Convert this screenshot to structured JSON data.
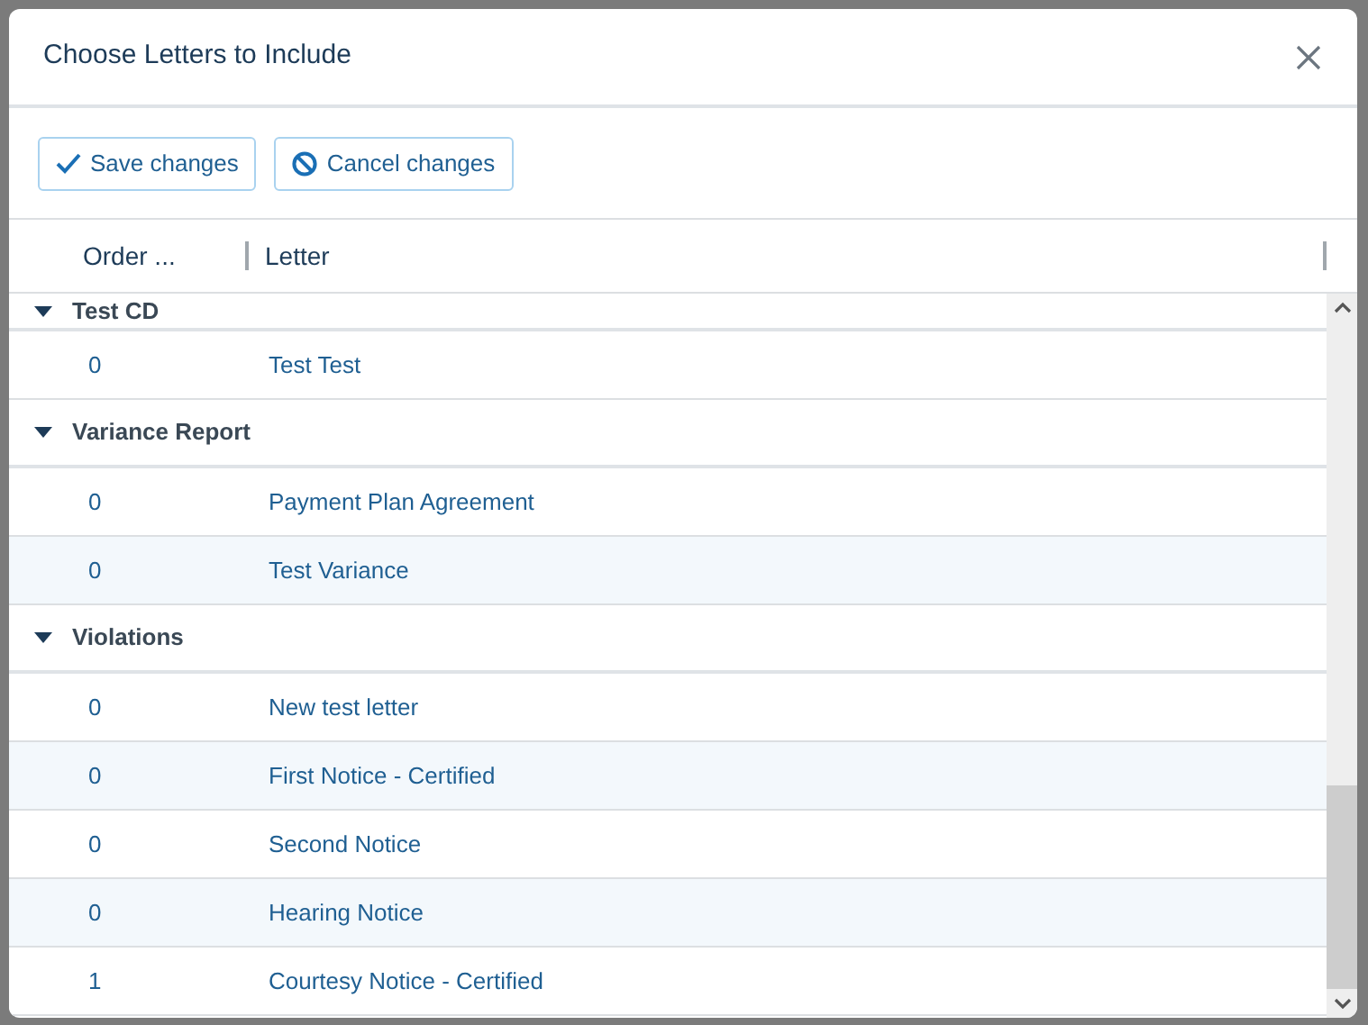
{
  "dialog": {
    "title": "Choose Letters to Include"
  },
  "toolbar": [
    {
      "kind": "save",
      "label": "Save changes"
    },
    {
      "kind": "cancel",
      "label": "Cancel changes"
    }
  ],
  "table": {
    "columns": [
      "Order ...",
      "Letter"
    ],
    "groups": [
      {
        "name": "Test CD",
        "expanded": true,
        "rows": [
          {
            "order": "0",
            "letter": "Test Test"
          }
        ]
      },
      {
        "name": "Variance Report",
        "expanded": true,
        "rows": [
          {
            "order": "0",
            "letter": "Payment Plan Agreement"
          },
          {
            "order": "0",
            "letter": "Test Variance"
          }
        ]
      },
      {
        "name": "Violations",
        "expanded": true,
        "rows": [
          {
            "order": "0",
            "letter": "New test letter"
          },
          {
            "order": "0",
            "letter": "First Notice - Certified"
          },
          {
            "order": "0",
            "letter": "Second Notice"
          },
          {
            "order": "0",
            "letter": "Hearing Notice"
          },
          {
            "order": "1",
            "letter": "Courtesy Notice - Certified"
          }
        ]
      }
    ]
  }
}
